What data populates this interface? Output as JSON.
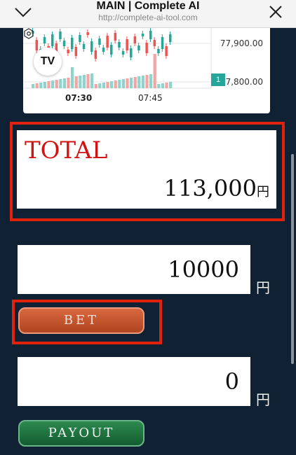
{
  "header": {
    "title": "MAIN | Complete AI",
    "url": "http://complete-ai-tool.com"
  },
  "chart": {
    "price_labels": [
      "77,900.00",
      "7,800.00"
    ],
    "time_labels": [
      "07:30",
      "07:45"
    ],
    "badge": "1",
    "logo_text": "TV",
    "colors": {
      "up": "#26a69a",
      "down": "#ef5350",
      "up_volume": "#8fd3cc",
      "down_volume": "#f2a5a3"
    }
  },
  "total": {
    "label": "TOTAL",
    "value": "113,000",
    "currency": "円"
  },
  "bet": {
    "amount": "10000",
    "currency": "円",
    "button_label": "BET"
  },
  "payout": {
    "amount": "0",
    "currency": "円",
    "button_label": "PAYOUT"
  },
  "colors": {
    "background": "#0f2133",
    "highlight_frame": "#e0220d",
    "bet_button": "#c2532d",
    "payout_button": "#1e6f3c"
  }
}
